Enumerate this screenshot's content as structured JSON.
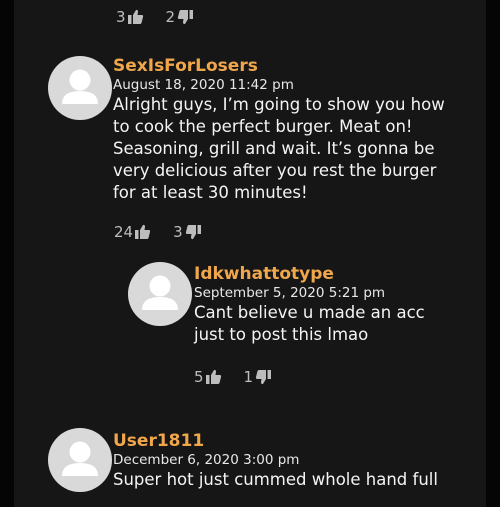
{
  "colors": {
    "background": "#050505",
    "panel": "#161616",
    "username": "#f0a64b",
    "text": "#f4f4f4",
    "meta": "#e8e8e8",
    "vote": "#bdbdbd",
    "avatar": "#d9d9d9"
  },
  "icons": {
    "upvote": "thumbs-up-icon",
    "downvote": "thumbs-down-icon",
    "avatar": "default-user-avatar-icon"
  },
  "top_votes": {
    "up": "3",
    "down": "2"
  },
  "comments": [
    {
      "username": "SexIsForLosers",
      "date": "August 18, 2020 11:42 pm",
      "lines": [
        "Alright guys, I’m going to show you how",
        "to cook the perfect burger. Meat on!",
        "Seasoning, grill and wait. It’s gonna be",
        "very delicious after you rest the burger",
        "for at least 30 minutes!"
      ],
      "votes": {
        "up": "24",
        "down": "3"
      }
    },
    {
      "username": "Idkwhattotype",
      "date": "September 5, 2020 5:21 pm",
      "lines": [
        "Cant believe u made an acc",
        "just to post this lmao"
      ],
      "votes": {
        "up": "5",
        "down": "1"
      }
    },
    {
      "username": "User1811",
      "date": "December 6, 2020 3:00 pm",
      "lines": [
        "Super hot just cummed whole hand full"
      ]
    }
  ]
}
